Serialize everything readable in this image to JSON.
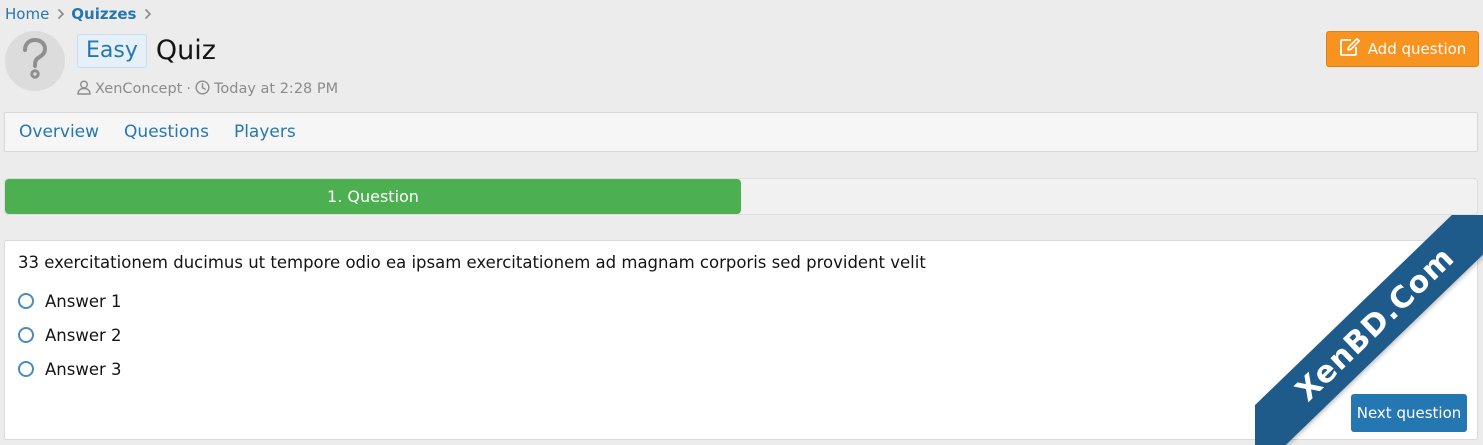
{
  "breadcrumb": {
    "items": [
      "Home",
      "Quizzes"
    ]
  },
  "header": {
    "badge": "Easy",
    "title": "Quiz",
    "author": "XenConcept",
    "separator": "·",
    "date": "Today at 2:28 PM",
    "avatar_icon": "question-mark-icon",
    "add_button_label": "Add question"
  },
  "tabs": [
    {
      "label": "Overview"
    },
    {
      "label": "Questions"
    },
    {
      "label": "Players"
    }
  ],
  "progress": {
    "label": "1. Question",
    "fraction": 0.5,
    "color": "#4caf50"
  },
  "question": {
    "text": "33 exercitationem ducimus ut tempore odio ea ipsam exercitationem ad magnam corporis sed provident velit",
    "answers": [
      {
        "label": "Answer 1"
      },
      {
        "label": "Answer 2"
      },
      {
        "label": "Answer 3"
      }
    ],
    "next_button_label": "Next question"
  },
  "watermark": {
    "text": "XenBD.Com"
  },
  "colors": {
    "link": "#2577b1",
    "accent_orange": "#f7931e",
    "primary_button": "#2577b1",
    "progress_green": "#4caf50"
  }
}
